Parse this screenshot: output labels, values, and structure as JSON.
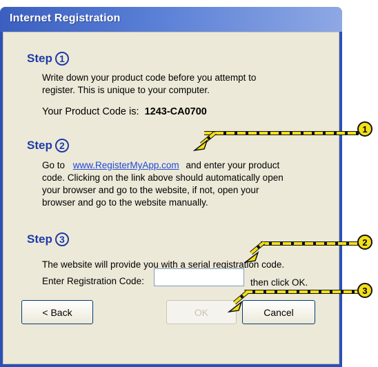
{
  "window": {
    "title": "Internet Registration"
  },
  "step1": {
    "label": "Step",
    "number": "1",
    "line1": "Write down your product code before you attempt to",
    "line2": "register.  This is unique to your computer.",
    "code_label": "Your Product Code is:",
    "code_value": "1243-CA0700"
  },
  "step2": {
    "label": "Step",
    "number": "2",
    "goto": "Go to",
    "link": "www.RegisterMyApp.com",
    "after_link": "and enter your product",
    "line2": "code.  Clicking on the link above should automatically open",
    "line3": "your browser and go to the website, if not, open your",
    "line4": "browser and go to the website manually."
  },
  "step3": {
    "label": "Step",
    "number": "3",
    "line1": "The website will provide you with a serial registration code.",
    "input_label": "Enter Registration Code:",
    "input_value": "",
    "after_input": "then click OK."
  },
  "buttons": {
    "back": "< Back",
    "ok": "OK",
    "cancel": "Cancel"
  },
  "callouts": [
    "1",
    "2",
    "3"
  ],
  "colors": {
    "accent": "#1f3aa8",
    "link": "#2047d6",
    "callout": "#f4df18"
  }
}
